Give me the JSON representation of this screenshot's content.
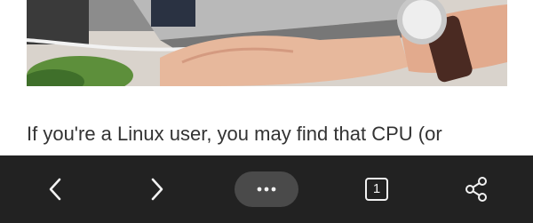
{
  "article": {
    "paragraph_text": "If you're a Linux user, you may find that CPU (or"
  },
  "toolbar": {
    "tab_count": "1",
    "icons": [
      "chevron-left-icon",
      "chevron-right-icon",
      "more-horizontal-icon",
      "tab-count-icon",
      "share-icon"
    ]
  },
  "colors": {
    "toolbar_background": "#222222",
    "menu_pill": "#4a4a4a",
    "icon_color": "#f2f2f2",
    "body_text": "#333333"
  }
}
